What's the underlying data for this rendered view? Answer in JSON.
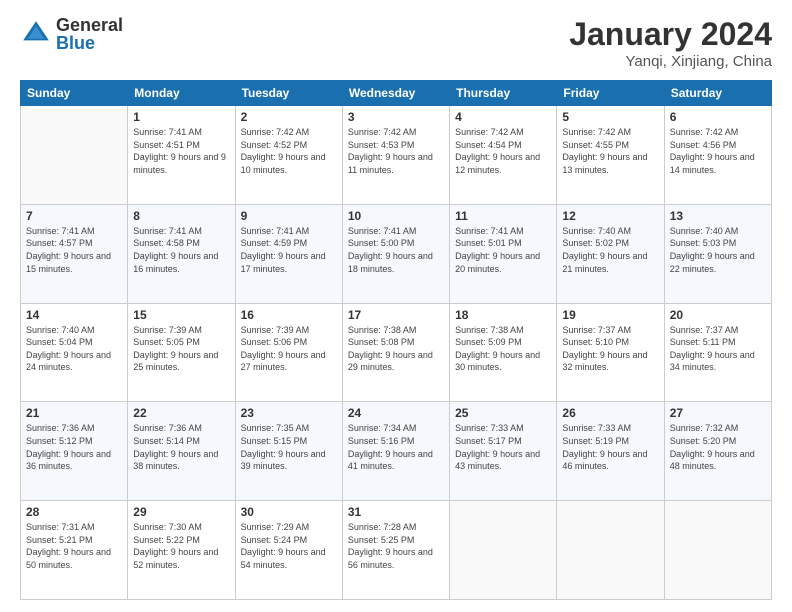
{
  "logo": {
    "general": "General",
    "blue": "Blue"
  },
  "title": "January 2024",
  "location": "Yanqi, Xinjiang, China",
  "header_days": [
    "Sunday",
    "Monday",
    "Tuesday",
    "Wednesday",
    "Thursday",
    "Friday",
    "Saturday"
  ],
  "weeks": [
    [
      {
        "day": "",
        "sunrise": "",
        "sunset": "",
        "daylight": ""
      },
      {
        "day": "1",
        "sunrise": "Sunrise: 7:41 AM",
        "sunset": "Sunset: 4:51 PM",
        "daylight": "Daylight: 9 hours and 9 minutes."
      },
      {
        "day": "2",
        "sunrise": "Sunrise: 7:42 AM",
        "sunset": "Sunset: 4:52 PM",
        "daylight": "Daylight: 9 hours and 10 minutes."
      },
      {
        "day": "3",
        "sunrise": "Sunrise: 7:42 AM",
        "sunset": "Sunset: 4:53 PM",
        "daylight": "Daylight: 9 hours and 11 minutes."
      },
      {
        "day": "4",
        "sunrise": "Sunrise: 7:42 AM",
        "sunset": "Sunset: 4:54 PM",
        "daylight": "Daylight: 9 hours and 12 minutes."
      },
      {
        "day": "5",
        "sunrise": "Sunrise: 7:42 AM",
        "sunset": "Sunset: 4:55 PM",
        "daylight": "Daylight: 9 hours and 13 minutes."
      },
      {
        "day": "6",
        "sunrise": "Sunrise: 7:42 AM",
        "sunset": "Sunset: 4:56 PM",
        "daylight": "Daylight: 9 hours and 14 minutes."
      }
    ],
    [
      {
        "day": "7",
        "sunrise": "Sunrise: 7:41 AM",
        "sunset": "Sunset: 4:57 PM",
        "daylight": "Daylight: 9 hours and 15 minutes."
      },
      {
        "day": "8",
        "sunrise": "Sunrise: 7:41 AM",
        "sunset": "Sunset: 4:58 PM",
        "daylight": "Daylight: 9 hours and 16 minutes."
      },
      {
        "day": "9",
        "sunrise": "Sunrise: 7:41 AM",
        "sunset": "Sunset: 4:59 PM",
        "daylight": "Daylight: 9 hours and 17 minutes."
      },
      {
        "day": "10",
        "sunrise": "Sunrise: 7:41 AM",
        "sunset": "Sunset: 5:00 PM",
        "daylight": "Daylight: 9 hours and 18 minutes."
      },
      {
        "day": "11",
        "sunrise": "Sunrise: 7:41 AM",
        "sunset": "Sunset: 5:01 PM",
        "daylight": "Daylight: 9 hours and 20 minutes."
      },
      {
        "day": "12",
        "sunrise": "Sunrise: 7:40 AM",
        "sunset": "Sunset: 5:02 PM",
        "daylight": "Daylight: 9 hours and 21 minutes."
      },
      {
        "day": "13",
        "sunrise": "Sunrise: 7:40 AM",
        "sunset": "Sunset: 5:03 PM",
        "daylight": "Daylight: 9 hours and 22 minutes."
      }
    ],
    [
      {
        "day": "14",
        "sunrise": "Sunrise: 7:40 AM",
        "sunset": "Sunset: 5:04 PM",
        "daylight": "Daylight: 9 hours and 24 minutes."
      },
      {
        "day": "15",
        "sunrise": "Sunrise: 7:39 AM",
        "sunset": "Sunset: 5:05 PM",
        "daylight": "Daylight: 9 hours and 25 minutes."
      },
      {
        "day": "16",
        "sunrise": "Sunrise: 7:39 AM",
        "sunset": "Sunset: 5:06 PM",
        "daylight": "Daylight: 9 hours and 27 minutes."
      },
      {
        "day": "17",
        "sunrise": "Sunrise: 7:38 AM",
        "sunset": "Sunset: 5:08 PM",
        "daylight": "Daylight: 9 hours and 29 minutes."
      },
      {
        "day": "18",
        "sunrise": "Sunrise: 7:38 AM",
        "sunset": "Sunset: 5:09 PM",
        "daylight": "Daylight: 9 hours and 30 minutes."
      },
      {
        "day": "19",
        "sunrise": "Sunrise: 7:37 AM",
        "sunset": "Sunset: 5:10 PM",
        "daylight": "Daylight: 9 hours and 32 minutes."
      },
      {
        "day": "20",
        "sunrise": "Sunrise: 7:37 AM",
        "sunset": "Sunset: 5:11 PM",
        "daylight": "Daylight: 9 hours and 34 minutes."
      }
    ],
    [
      {
        "day": "21",
        "sunrise": "Sunrise: 7:36 AM",
        "sunset": "Sunset: 5:12 PM",
        "daylight": "Daylight: 9 hours and 36 minutes."
      },
      {
        "day": "22",
        "sunrise": "Sunrise: 7:36 AM",
        "sunset": "Sunset: 5:14 PM",
        "daylight": "Daylight: 9 hours and 38 minutes."
      },
      {
        "day": "23",
        "sunrise": "Sunrise: 7:35 AM",
        "sunset": "Sunset: 5:15 PM",
        "daylight": "Daylight: 9 hours and 39 minutes."
      },
      {
        "day": "24",
        "sunrise": "Sunrise: 7:34 AM",
        "sunset": "Sunset: 5:16 PM",
        "daylight": "Daylight: 9 hours and 41 minutes."
      },
      {
        "day": "25",
        "sunrise": "Sunrise: 7:33 AM",
        "sunset": "Sunset: 5:17 PM",
        "daylight": "Daylight: 9 hours and 43 minutes."
      },
      {
        "day": "26",
        "sunrise": "Sunrise: 7:33 AM",
        "sunset": "Sunset: 5:19 PM",
        "daylight": "Daylight: 9 hours and 46 minutes."
      },
      {
        "day": "27",
        "sunrise": "Sunrise: 7:32 AM",
        "sunset": "Sunset: 5:20 PM",
        "daylight": "Daylight: 9 hours and 48 minutes."
      }
    ],
    [
      {
        "day": "28",
        "sunrise": "Sunrise: 7:31 AM",
        "sunset": "Sunset: 5:21 PM",
        "daylight": "Daylight: 9 hours and 50 minutes."
      },
      {
        "day": "29",
        "sunrise": "Sunrise: 7:30 AM",
        "sunset": "Sunset: 5:22 PM",
        "daylight": "Daylight: 9 hours and 52 minutes."
      },
      {
        "day": "30",
        "sunrise": "Sunrise: 7:29 AM",
        "sunset": "Sunset: 5:24 PM",
        "daylight": "Daylight: 9 hours and 54 minutes."
      },
      {
        "day": "31",
        "sunrise": "Sunrise: 7:28 AM",
        "sunset": "Sunset: 5:25 PM",
        "daylight": "Daylight: 9 hours and 56 minutes."
      },
      {
        "day": "",
        "sunrise": "",
        "sunset": "",
        "daylight": ""
      },
      {
        "day": "",
        "sunrise": "",
        "sunset": "",
        "daylight": ""
      },
      {
        "day": "",
        "sunrise": "",
        "sunset": "",
        "daylight": ""
      }
    ]
  ]
}
